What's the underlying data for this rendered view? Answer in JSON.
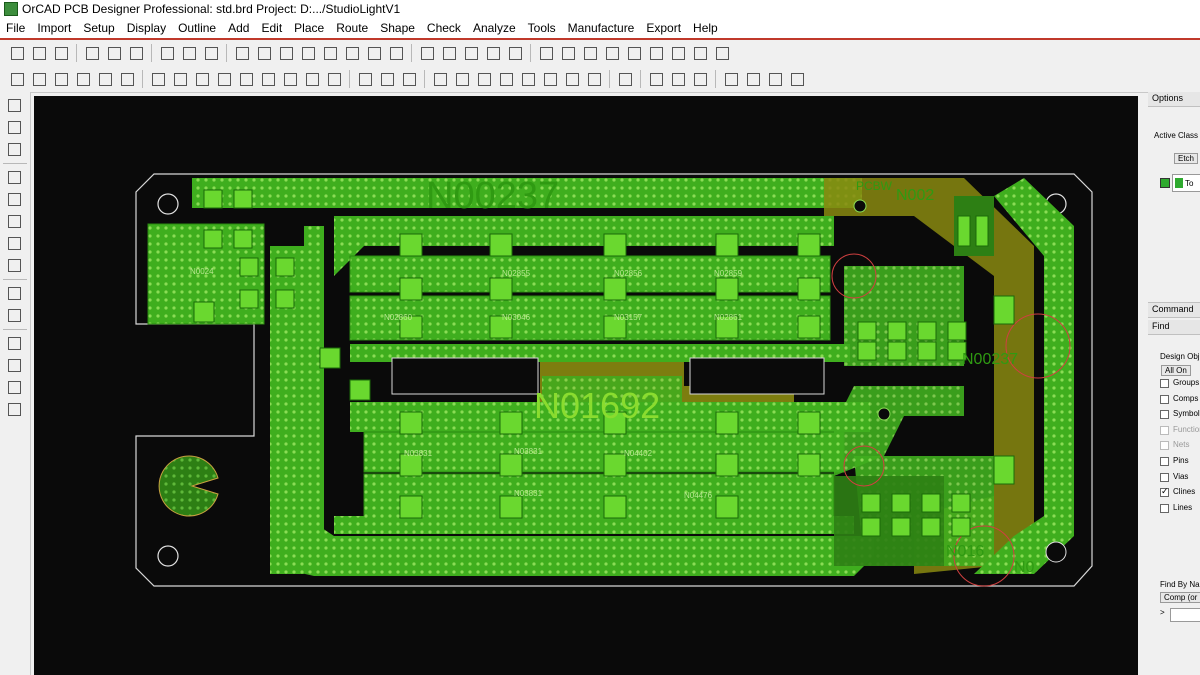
{
  "window": {
    "title": "OrCAD PCB Designer Professional: std.brd  Project: D:.../StudioLightV1"
  },
  "menu": [
    "File",
    "Import",
    "Setup",
    "Display",
    "Outline",
    "Add",
    "Edit",
    "Place",
    "Route",
    "Shape",
    "Check",
    "Analyze",
    "Tools",
    "Manufacture",
    "Export",
    "Help"
  ],
  "toolbar1_icons": [
    "new-icon",
    "open-icon",
    "save-icon",
    "|",
    "move-icon",
    "copy-icon",
    "delete-icon",
    "|",
    "undo-icon",
    "redo-icon",
    "pin-icon",
    "|",
    "grid-icon",
    "zoom-points-icon",
    "zoom-fit-icon",
    "zoom-in-icon",
    "zoom-out-icon",
    "zoom-previous-icon",
    "zoom-world-icon",
    "3d-view-icon",
    "|",
    "layer-grid-icon",
    "color-icon",
    "properties-icon",
    "layers-icon",
    "film-icon",
    "|",
    "info-icon",
    "measure-icon",
    "counter-icon",
    "highlight-icon",
    "sun-icon",
    "bulb-icon",
    "stats-icon",
    "timer-icon",
    "select-active-icon"
  ],
  "toolbar2_icons": [
    "layer1-icon",
    "layer2-icon",
    "layer3-icon",
    "layer4-icon",
    "layer5-icon",
    "layer6-icon",
    "|",
    "shape-rect-icon",
    "shape-rect2-icon",
    "shape-circle-icon",
    "shape-poly-icon",
    "shape-cut-icon",
    "shape-void-icon",
    "shape-merge-icon",
    "shape-edit-icon",
    "shape-select-icon",
    "|",
    "dimension-icon",
    "dimension2-icon",
    "dimension3-icon",
    "|",
    "place-icon",
    "place2-icon",
    "place3-icon",
    "place4-icon",
    "place5-icon",
    "place6-icon",
    "place7-icon",
    "place8-icon",
    "|",
    "route-icon",
    "|",
    "swap-icon",
    "swap2-icon",
    "swap3-icon",
    "|",
    "window-icon",
    "window2-icon",
    "window3-icon",
    "help-icon"
  ],
  "left_toolbar_icons": [
    "add-connect-icon",
    "slide-icon",
    "delay-tune-icon",
    "|",
    "route-custom-icon",
    "route-spread-icon",
    "route-bubble-icon",
    "route-fanout-icon",
    "route-auto-icon",
    "|",
    "route-interactive-icon",
    "route-group-icon",
    "|",
    "line-icon",
    "rectangle-icon",
    "text-icon",
    "text-edit-icon"
  ],
  "board": {
    "big_net_labels": [
      "N00237",
      "N01692"
    ],
    "small_net_labels": [
      "N002",
      "N00237",
      "N016",
      "N0",
      "PCBW",
      "LED",
      "LED"
    ],
    "pad_labels": [
      "N02855",
      "N02856",
      "N03046",
      "N03157",
      "N02859",
      "N02860",
      "N02861",
      "N03831",
      "N04402",
      "N03831",
      "N03831",
      "N04476",
      "N00237",
      "N00237",
      "N0024"
    ]
  },
  "options": {
    "title": "Options",
    "active_class_label": "Active Class a",
    "active_class_value": "Etch",
    "subclass_value": "To"
  },
  "command": {
    "title": "Command"
  },
  "find": {
    "title": "Find",
    "design_objects_label": "Design Obje",
    "all_on": "All On",
    "items": [
      {
        "label": "Groups",
        "checked": false,
        "enabled": true
      },
      {
        "label": "Comps",
        "checked": false,
        "enabled": true
      },
      {
        "label": "Symbols",
        "checked": false,
        "enabled": true
      },
      {
        "label": "Functions",
        "checked": false,
        "enabled": false
      },
      {
        "label": "Nets",
        "checked": false,
        "enabled": false
      },
      {
        "label": "Pins",
        "checked": false,
        "enabled": true
      },
      {
        "label": "Vias",
        "checked": false,
        "enabled": true
      },
      {
        "label": "Clines",
        "checked": true,
        "enabled": true
      },
      {
        "label": "Lines",
        "checked": false,
        "enabled": true
      }
    ],
    "find_by_name_label": "Find By Na",
    "find_by_name_type": "Comp (or P",
    "find_by_name_arrow": ">"
  },
  "colors": {
    "copper": "#3fae1e",
    "copper_bright": "#6ad82f",
    "copper_olive": "#8a8a10",
    "board_bg": "#0a0a0a",
    "outline": "#d8d8d8",
    "accent_red": "#c0392b"
  }
}
